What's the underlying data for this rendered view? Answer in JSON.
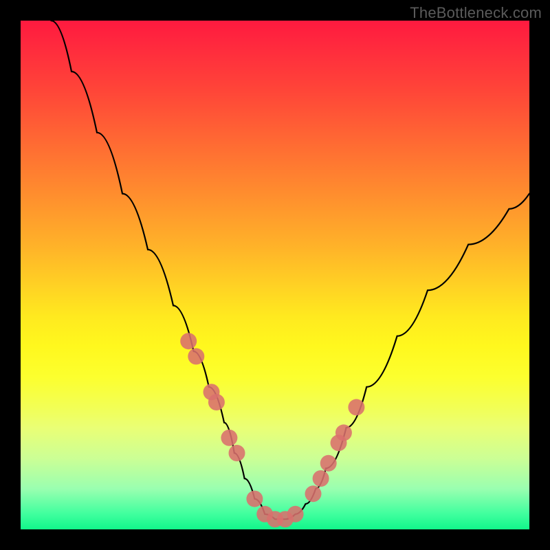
{
  "watermark": "TheBottleneck.com",
  "chart_data": {
    "type": "line",
    "title": "",
    "xlabel": "",
    "ylabel": "",
    "xlim": [
      0,
      100
    ],
    "ylim": [
      0,
      100
    ],
    "grid": false,
    "legend": false,
    "series": [
      {
        "name": "bottleneck-curve",
        "color": "#000000",
        "x": [
          6,
          10,
          15,
          20,
          25,
          30,
          34,
          37,
          40,
          42,
          44,
          46,
          48,
          50,
          52,
          54,
          56,
          58,
          60,
          64,
          68,
          74,
          80,
          88,
          96,
          100
        ],
        "y": [
          100,
          90,
          78,
          66,
          55,
          44,
          35,
          28,
          21,
          15,
          10,
          6,
          3,
          2,
          2,
          3,
          5,
          8,
          12,
          20,
          28,
          38,
          47,
          56,
          63,
          66
        ]
      }
    ],
    "markers": [
      {
        "name": "highlight-dots",
        "color": "#d96f6d",
        "radius": 12,
        "x": [
          33.0,
          34.5,
          37.5,
          38.5,
          41.0,
          42.5,
          46.0,
          48.0,
          50.0,
          52.0,
          54.0,
          57.5,
          59.0,
          60.5,
          62.5,
          63.5,
          66.0
        ],
        "y": [
          37,
          34,
          27,
          25,
          18,
          15,
          6,
          3,
          2,
          2,
          3,
          7,
          10,
          13,
          17,
          19,
          24
        ]
      }
    ]
  }
}
